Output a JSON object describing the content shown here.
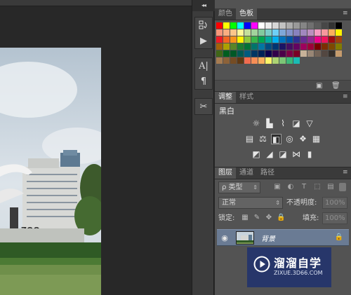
{
  "swatches_panel": {
    "tabs": [
      "颜色",
      "色板"
    ],
    "active_tab": 1,
    "colors": [
      "#ff0000",
      "#ffff00",
      "#00ff00",
      "#00ffff",
      "#0000ff",
      "#ff00ff",
      "#ffffff",
      "#ebebeb",
      "#d6d6d6",
      "#c2c2c2",
      "#adadad",
      "#999999",
      "#858585",
      "#707070",
      "#5c5c5c",
      "#474747",
      "#333333",
      "#000000",
      "#f7977a",
      "#f9ad81",
      "#fdc68a",
      "#fff79a",
      "#c4df9b",
      "#a2d39c",
      "#82ca9d",
      "#7bcdc8",
      "#6ecff6",
      "#7ea7d8",
      "#8493ca",
      "#8882be",
      "#a187be",
      "#bc8dbf",
      "#f49ac2",
      "#f6989d",
      "#fbaf5d",
      "#fff200",
      "#ed1c24",
      "#f26522",
      "#f7941d",
      "#fff200",
      "#8dc73f",
      "#39b54a",
      "#00a651",
      "#00a99d",
      "#00aeef",
      "#0072bc",
      "#0054a6",
      "#2e3192",
      "#662d91",
      "#92278f",
      "#ec008c",
      "#ed145b",
      "#9e0b0f",
      "#a0410d",
      "#a36209",
      "#aba000",
      "#598527",
      "#1a7b30",
      "#007236",
      "#00746b",
      "#0076a3",
      "#004b80",
      "#003471",
      "#1b1464",
      "#440e62",
      "#630460",
      "#9e005d",
      "#9e0039",
      "#790000",
      "#7b2e00",
      "#7d4900",
      "#827b00",
      "#406618",
      "#005e20",
      "#005826",
      "#005952",
      "#005b7f",
      "#003663",
      "#002157",
      "#0d004c",
      "#32004b",
      "#4b0049",
      "#7b0046",
      "#7a0026",
      "#c7b299",
      "#998675",
      "#736357",
      "#534741",
      "#37302a",
      "#c69c6d",
      "#a67c52",
      "#8c6239",
      "#754c24",
      "#603913",
      "#f26c4f",
      "#f68e56",
      "#fbaf5d",
      "#fff568",
      "#acd372",
      "#7cc576",
      "#3bb878",
      "#1abbb4"
    ]
  },
  "adjustments_panel": {
    "tabs": [
      "调整",
      "样式"
    ],
    "active_tab": 0,
    "title": "黑白",
    "icons_row1": [
      "brightness-icon",
      "levels-icon",
      "curves-icon",
      "exposure-icon",
      "gradient-triangle-icon"
    ],
    "icons_row2": [
      "vibrance-icon",
      "balance-icon",
      "black-white-icon",
      "photo-filter-icon",
      "channel-mixer-icon",
      "color-lookup-icon"
    ],
    "icons_row3": [
      "invert-icon",
      "posterize-icon",
      "threshold-icon",
      "selective-color-icon",
      "gradient-map-icon"
    ]
  },
  "layers_panel": {
    "tabs": [
      "图层",
      "通道",
      "路径"
    ],
    "active_tab": 0,
    "filter_label": "ρ 类型",
    "blend_mode": "正常",
    "opacity_label": "不透明度:",
    "opacity_value": "100%",
    "lock_label": "锁定:",
    "fill_label": "填充:",
    "fill_value": "100%",
    "layers": [
      {
        "name": "背景",
        "visible": true,
        "locked": true
      }
    ]
  },
  "watermark": {
    "title": "溜溜自学",
    "url": "ZIXUE.3D66.COM"
  }
}
